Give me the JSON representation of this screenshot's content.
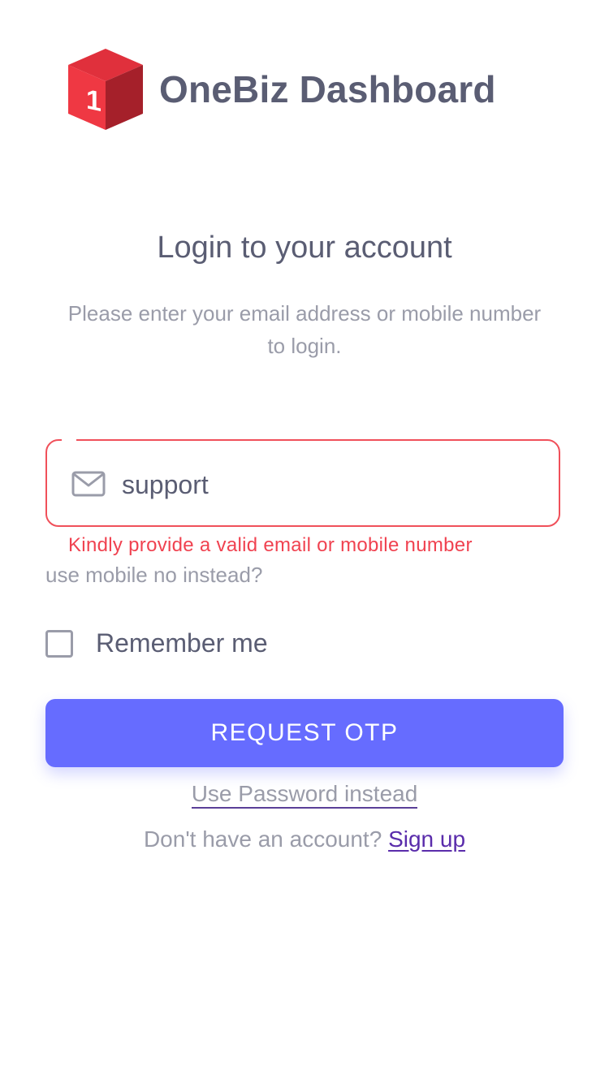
{
  "brand": {
    "name": "OneBiz Dashboard",
    "logo_icon": "red-cube-logo",
    "logo_numeral": "1"
  },
  "login": {
    "title": "Login to your account",
    "subtitle": "Please enter your email address or mobile number to login."
  },
  "identifier_field": {
    "value": "support",
    "icon": "mail-icon",
    "state": "error",
    "error_text": "Kindly provide a valid email or mobile number"
  },
  "alt_login_link": "use mobile no instead?",
  "remember_me": {
    "label": "Remember me",
    "checked": false
  },
  "primary_button": {
    "label": "REQUEST OTP"
  },
  "password_link": "Use Password instead",
  "signup": {
    "prompt": "Don't have an account?",
    "link_label": "Sign up"
  },
  "colors": {
    "primary": "#666cff",
    "error": "#f04250",
    "heading_text": "#5a5d73",
    "muted_text": "#9a9ca9",
    "link": "#5a2cab",
    "logo_red": "#d9242f"
  }
}
